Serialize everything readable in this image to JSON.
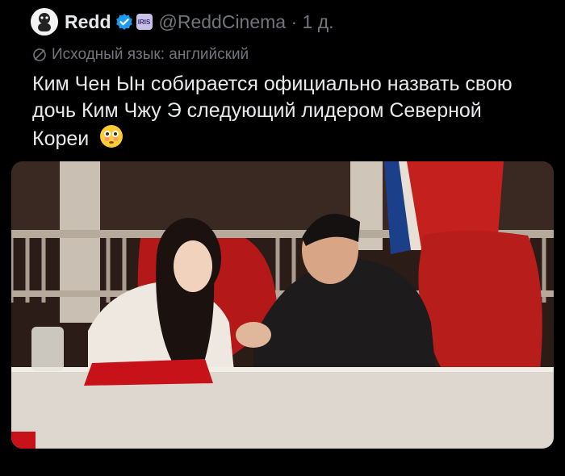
{
  "tweet": {
    "author_name": "Redd",
    "affiliate_badge": "IRIS",
    "handle": "@ReddCinema",
    "dot": "·",
    "time": "1 д.",
    "translation_label": "Исходный язык: английский",
    "text": "Ким Чен Ын собирается официально назвать свою дочь Ким Чжу Э следующий лидером Северной Кореи",
    "emoji": "flushed-face-emoji"
  },
  "icons": {
    "verified": "verified-badge-icon",
    "translate": "translate-globe-icon"
  },
  "colors": {
    "background": "#000000",
    "text": "#e7e9ea",
    "muted": "#71767b",
    "verified": "#1d9bf0"
  }
}
